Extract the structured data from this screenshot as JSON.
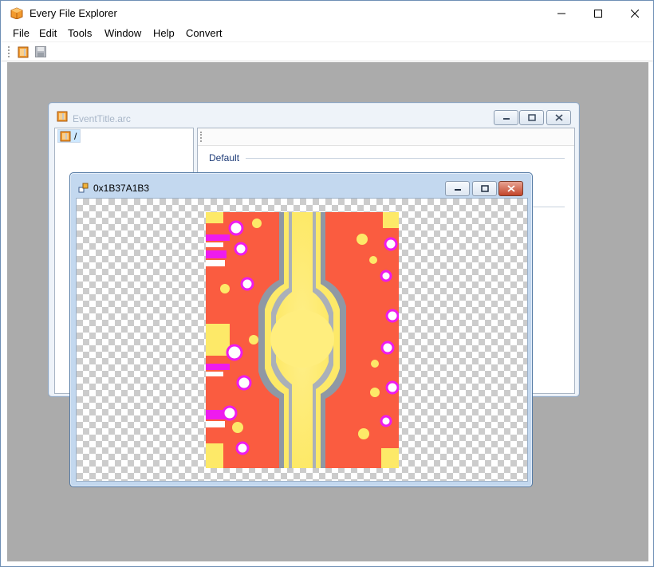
{
  "app": {
    "title": "Every File Explorer",
    "icons": {
      "app": "box-icon",
      "open": "open-file-icon",
      "save": "save-icon"
    }
  },
  "menu": [
    {
      "label": "File"
    },
    {
      "label": "Edit"
    },
    {
      "label": "Tools"
    },
    {
      "label": "Window"
    },
    {
      "label": "Help"
    },
    {
      "label": "Convert"
    }
  ],
  "arc_window": {
    "title": "EventTitle.arc",
    "tree_root": "/",
    "group_label": "Default"
  },
  "image_window": {
    "title": "0x1B37A1B3"
  },
  "colors": {
    "texture_red": "#fa5c40",
    "texture_yellow": "#fde968",
    "texture_magenta": "#ee1bee",
    "texture_gray": "#8f98a4",
    "mdi_background": "#ababab"
  }
}
